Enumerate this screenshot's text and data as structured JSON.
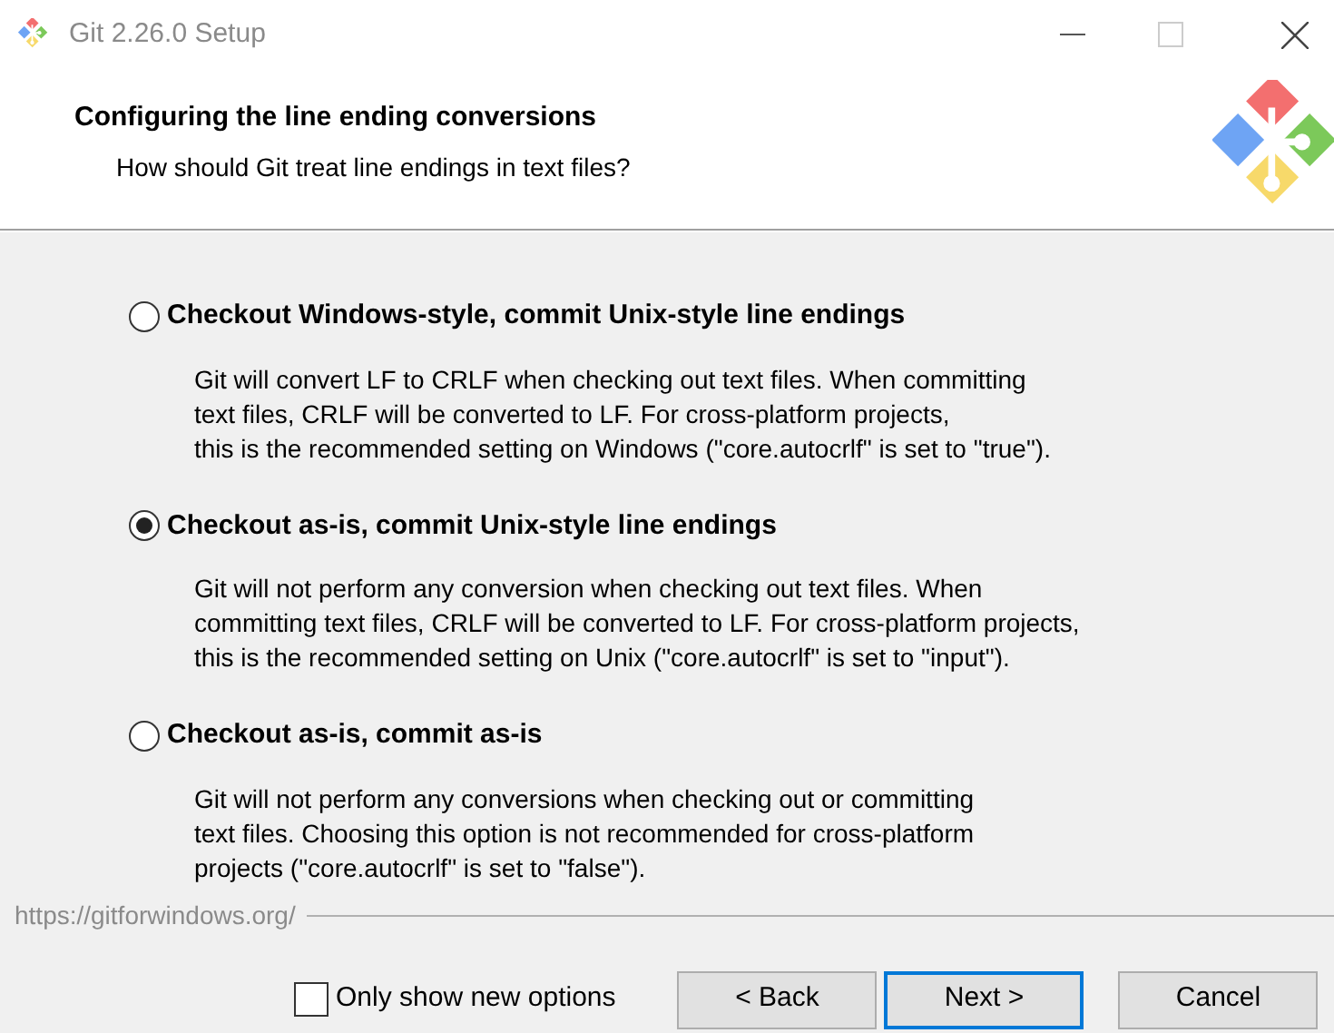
{
  "window": {
    "title": "Git 2.26.0 Setup"
  },
  "header": {
    "title": "Configuring the line ending conversions",
    "subtitle": "How should Git treat line endings in text files?"
  },
  "options": [
    {
      "label": "Checkout Windows-style, commit Unix-style line endings",
      "selected": false,
      "description": [
        "Git will convert LF to CRLF when checking out text files. When committing",
        "text files, CRLF will be converted to LF. For cross-platform projects,",
        "this is the recommended setting on Windows (\"core.autocrlf\" is set to \"true\")."
      ]
    },
    {
      "label": "Checkout as-is, commit Unix-style line endings",
      "selected": true,
      "description": [
        "Git will not perform any conversion when checking out text files. When",
        "committing text files, CRLF will be converted to LF. For cross-platform projects,",
        "this is the recommended setting on Unix (\"core.autocrlf\" is set to \"input\")."
      ]
    },
    {
      "label": "Checkout as-is, commit as-is",
      "selected": false,
      "description": [
        "Git will not perform any conversions when checking out or committing",
        "text files. Choosing this option is not recommended for cross-platform",
        "projects (\"core.autocrlf\" is set to \"false\")."
      ]
    }
  ],
  "footer": {
    "link": "https://gitforwindows.org/",
    "checkbox": {
      "label": "Only show new options",
      "checked": false
    },
    "buttons": [
      {
        "label": "< Back",
        "default": false
      },
      {
        "label": "Next >",
        "default": true
      },
      {
        "label": "Cancel",
        "default": false
      }
    ]
  }
}
